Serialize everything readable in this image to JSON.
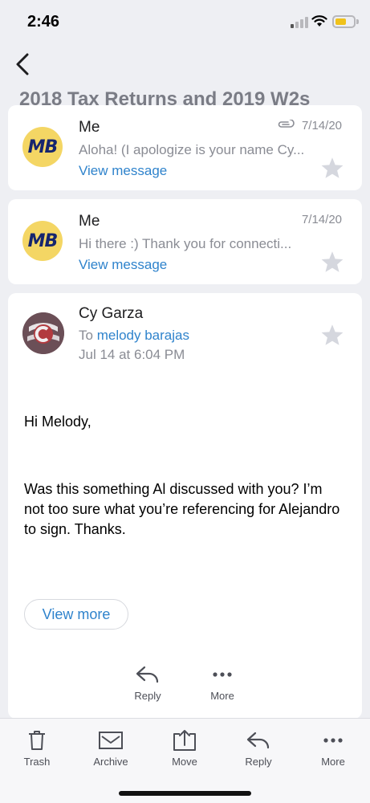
{
  "status": {
    "time": "2:46"
  },
  "thread": {
    "subject": "2018 Tax Returns and 2019 W2s"
  },
  "messages": [
    {
      "sender": "Me",
      "avatar_initials": "MB",
      "date": "7/14/20",
      "has_attachment": true,
      "snippet": "Aloha! (I apologize is your name Cy...",
      "view_label": "View message",
      "starred": false
    },
    {
      "sender": "Me",
      "avatar_initials": "MB",
      "date": "7/14/20",
      "has_attachment": false,
      "snippet": "Hi there :) Thank you for connecti...",
      "view_label": "View message",
      "starred": false
    }
  ],
  "open_message": {
    "sender": "Cy Garza",
    "to_prefix": "To",
    "recipient": "melody barajas",
    "sent": "Jul 14 at 6:04 PM",
    "greeting": "Hi Melody,",
    "body": "Was this something Al discussed with you? I’m not too sure what you’re referencing for Alejandro to sign. Thanks.",
    "view_more": "View more",
    "actions": {
      "reply": "Reply",
      "more": "More"
    }
  },
  "toolbar": {
    "trash": "Trash",
    "archive": "Archive",
    "move": "Move",
    "reply": "Reply",
    "more": "More"
  },
  "colors": {
    "accent": "#2f83cc",
    "avatar_bg": "#f4d664",
    "background": "#eeeff3"
  }
}
